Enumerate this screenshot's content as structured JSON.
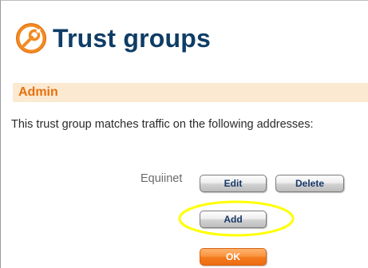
{
  "page": {
    "title": "Trust groups",
    "icon": "wrench-icon"
  },
  "section": {
    "title": "Admin",
    "description": "This trust group matches traffic on the following addresses:"
  },
  "addresses": [
    {
      "name": "Equiinet",
      "edit_label": "Edit",
      "delete_label": "Delete"
    }
  ],
  "actions": {
    "add_label": "Add",
    "ok_label": "OK"
  },
  "colors": {
    "title": "#0e3d66",
    "accent": "#e8700c",
    "section_bg": "#fce9d2",
    "highlight": "#ffff00"
  }
}
